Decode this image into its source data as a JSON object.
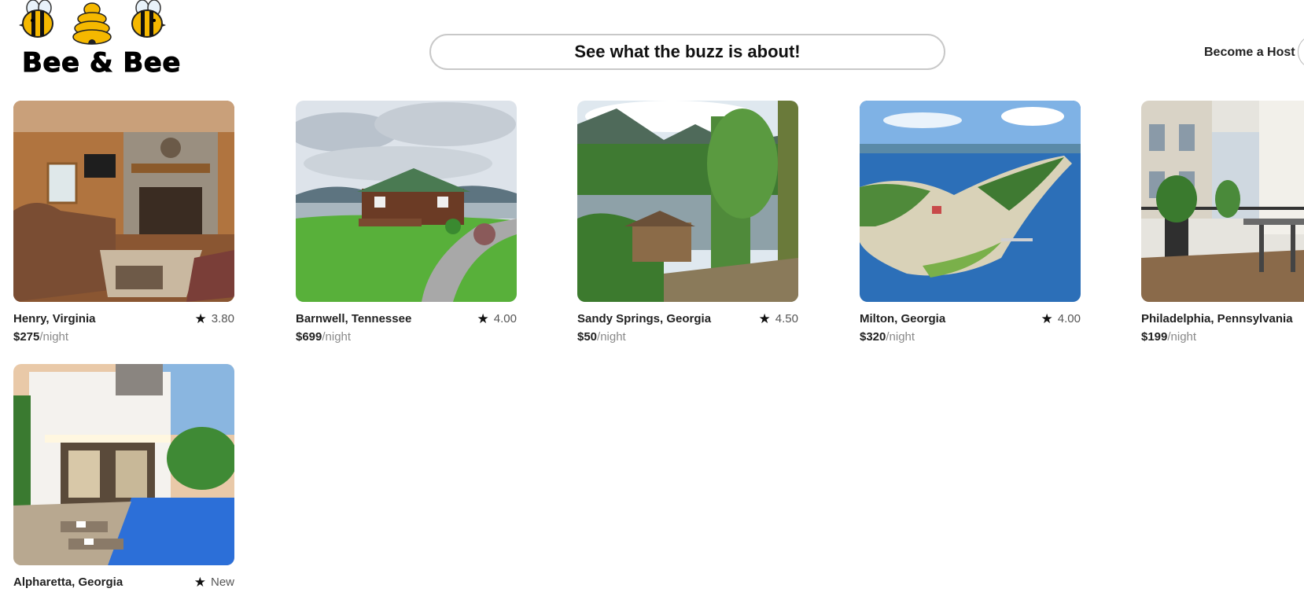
{
  "brand": {
    "name": "Bee & Bee",
    "icons": [
      "bee-icon",
      "beehive-icon",
      "bee-icon"
    ]
  },
  "search": {
    "label": "See what the buzz is about!"
  },
  "nav": {
    "host_link": "Become a Host"
  },
  "colors": {
    "accent_yellow": "#f5b800",
    "text": "#222222",
    "muted": "#8a8a8a"
  },
  "listings": [
    {
      "location": "Henry, Virginia",
      "rating": "3.80",
      "price": "$275",
      "unit": "/night",
      "photo": "cabin-living-room"
    },
    {
      "location": "Barnwell, Tennessee",
      "rating": "4.00",
      "price": "$699",
      "unit": "/night",
      "photo": "log-cabin-on-hill"
    },
    {
      "location": "Sandy Springs, Georgia",
      "rating": "4.50",
      "price": "$50",
      "unit": "/night",
      "photo": "lake-house-mountains"
    },
    {
      "location": "Milton, Georgia",
      "rating": "4.00",
      "price": "$320",
      "unit": "/night",
      "photo": "aerial-island-coast"
    },
    {
      "location": "Philadelphia, Pennsylvania",
      "rating": "",
      "price": "$199",
      "unit": "/night",
      "photo": "city-balcony-terrace"
    },
    {
      "location": "Alpharetta, Georgia",
      "rating": "New",
      "price": "",
      "unit": "",
      "photo": "modern-villa-pool"
    }
  ]
}
